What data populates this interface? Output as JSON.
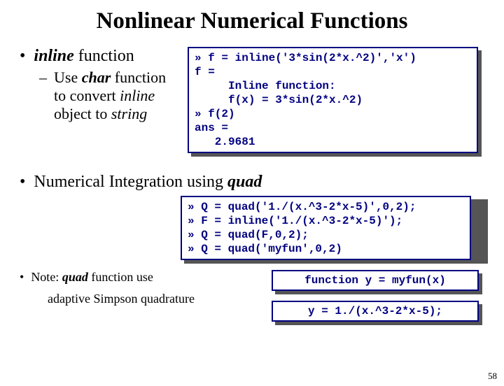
{
  "title": "Nonlinear Numerical Functions",
  "bullet1": {
    "prefix_italic": "inline",
    "suffix": " function"
  },
  "bullet2": {
    "part1": "Use ",
    "part2_bi": "char",
    "part3": " function to convert ",
    "part4_i": "inline",
    "part5": " object to ",
    "part6_i": "string"
  },
  "codebox1": "» f = inline('3*sin(2*x.^2)','x')\nf =\n     Inline function:\n     f(x) = 3*sin(2*x.^2)\n» f(2)\nans =\n   2.9681",
  "bullet3": {
    "part1": "Numerical Integration using ",
    "part2_bi": "quad"
  },
  "codebox2": "» Q = quad('1./(x.^3-2*x-5)',0,2);\n» F = inline('1./(x.^3-2*x-5)');\n» Q = quad(F,0,2);\n» Q = quad('myfun',0,2)",
  "note": {
    "part1": "Note: ",
    "part2_bi": "quad",
    "part3": " function use",
    "line2": "adaptive Simpson quadrature"
  },
  "codebox3": "function y = myfun(x)",
  "codebox4": "y = 1./(x.^3-2*x-5);",
  "page_num": "58"
}
